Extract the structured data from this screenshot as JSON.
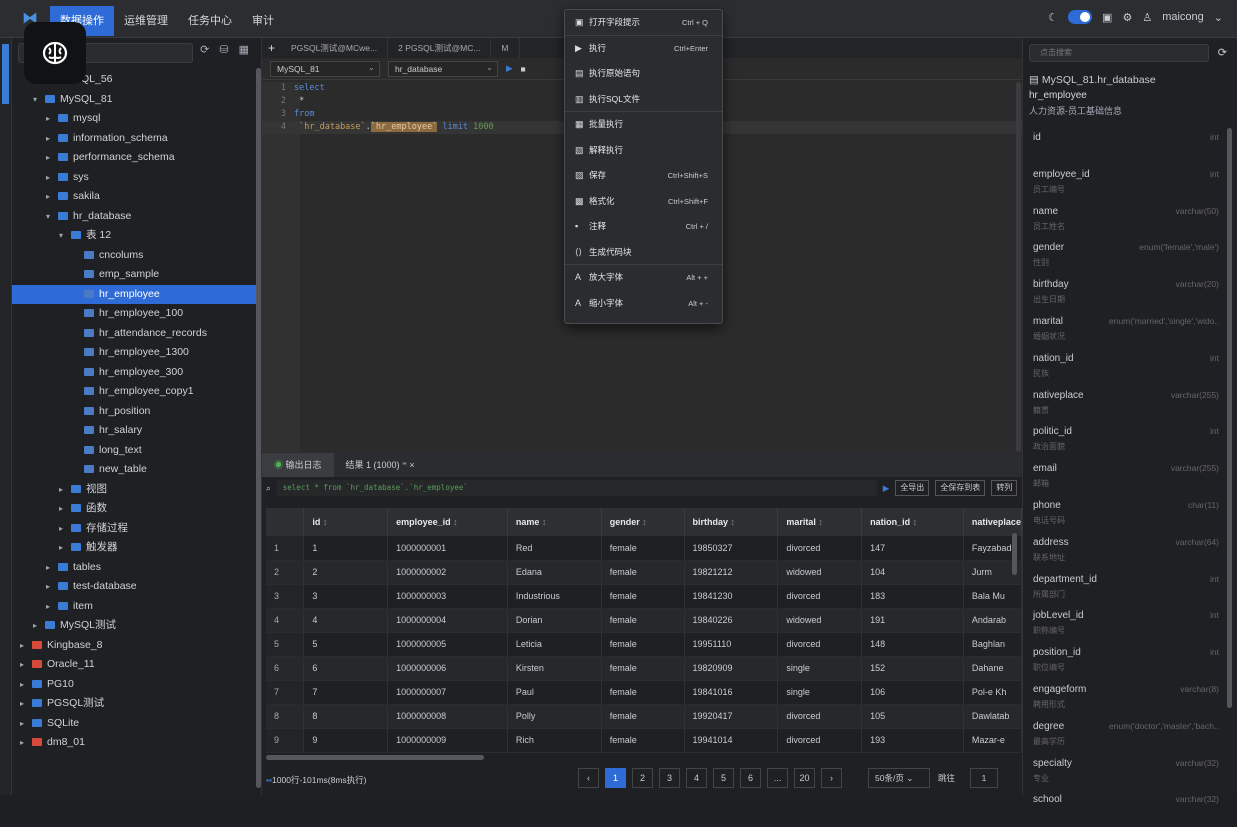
{
  "topbar": {
    "nav": [
      "数据操作",
      "运维管理",
      "任务中心",
      "审计"
    ],
    "user": "maicong"
  },
  "sidebar": {
    "tree": [
      {
        "label": "MySQL_56",
        "indent": 1,
        "arrow": "▸"
      },
      {
        "label": "MySQL_81",
        "indent": 1,
        "arrow": "▾"
      },
      {
        "label": "mysql",
        "indent": 2,
        "arrow": "▸"
      },
      {
        "label": "information_schema",
        "indent": 2,
        "arrow": "▸"
      },
      {
        "label": "performance_schema",
        "indent": 2,
        "arrow": "▸"
      },
      {
        "label": "sys",
        "indent": 2,
        "arrow": "▸"
      },
      {
        "label": "sakila",
        "indent": 2,
        "arrow": "▸"
      },
      {
        "label": "hr_database",
        "indent": 2,
        "arrow": "▾"
      },
      {
        "label": "表 12",
        "indent": 3,
        "arrow": "▾"
      },
      {
        "label": "cncolums",
        "indent": 4,
        "arrow": ""
      },
      {
        "label": "emp_sample",
        "indent": 4,
        "arrow": ""
      },
      {
        "label": "hr_employee",
        "indent": 4,
        "arrow": "",
        "selected": true
      },
      {
        "label": "hr_employee_100",
        "indent": 4,
        "arrow": ""
      },
      {
        "label": "hr_attendance_records",
        "indent": 4,
        "arrow": ""
      },
      {
        "label": "hr_employee_1300",
        "indent": 4,
        "arrow": ""
      },
      {
        "label": "hr_employee_300",
        "indent": 4,
        "arrow": ""
      },
      {
        "label": "hr_employee_copy1",
        "indent": 4,
        "arrow": ""
      },
      {
        "label": "hr_position",
        "indent": 4,
        "arrow": ""
      },
      {
        "label": "hr_salary",
        "indent": 4,
        "arrow": ""
      },
      {
        "label": "long_text",
        "indent": 4,
        "arrow": ""
      },
      {
        "label": "new_table",
        "indent": 4,
        "arrow": ""
      },
      {
        "label": "视图",
        "indent": 3,
        "arrow": "▸"
      },
      {
        "label": "函数",
        "indent": 3,
        "arrow": "▸"
      },
      {
        "label": "存储过程",
        "indent": 3,
        "arrow": "▸"
      },
      {
        "label": "触发器",
        "indent": 3,
        "arrow": "▸"
      },
      {
        "label": "tables",
        "indent": 2,
        "arrow": "▸"
      },
      {
        "label": "test-database",
        "indent": 2,
        "arrow": "▸"
      },
      {
        "label": "item",
        "indent": 2,
        "arrow": "▸"
      },
      {
        "label": "MySQL测试",
        "indent": 1,
        "arrow": "▸"
      },
      {
        "label": "Kingbase_8",
        "indent": 0,
        "arrow": "▸",
        "red": true
      },
      {
        "label": "Oracle_11",
        "indent": 0,
        "arrow": "▸",
        "red": true
      },
      {
        "label": "PG10",
        "indent": 0,
        "arrow": "▸"
      },
      {
        "label": "PGSQL测试",
        "indent": 0,
        "arrow": "▸"
      },
      {
        "label": "SQLite",
        "indent": 0,
        "arrow": "▸"
      },
      {
        "label": "dm8_01",
        "indent": 0,
        "arrow": "▸",
        "red": true
      }
    ]
  },
  "editor": {
    "tabs": [
      "PGSQL测试@MCwe...",
      "2 PGSQL测试@MC...",
      "M"
    ],
    "conn": "MySQL_81",
    "db": "hr_database"
  },
  "context_menu": {
    "items": [
      {
        "label": "打开字段提示",
        "shortcut": "Ctrl + Q",
        "icon": "▣"
      },
      {
        "label": "执行",
        "shortcut": "Ctrl+Enter",
        "icon": "▶"
      },
      {
        "label": "执行原始语句",
        "shortcut": "",
        "icon": "▤"
      },
      {
        "label": "执行SQL文件",
        "shortcut": "",
        "icon": "▥"
      },
      {
        "label": "批量执行",
        "shortcut": "",
        "icon": "▦"
      },
      {
        "label": "解释执行",
        "shortcut": "",
        "icon": "▧"
      },
      {
        "label": "保存",
        "shortcut": "Ctrl+Shift+S",
        "icon": "▨"
      },
      {
        "label": "格式化",
        "shortcut": "Ctrl+Shift+F",
        "icon": "▩"
      },
      {
        "label": "注释",
        "shortcut": "Ctrl + /",
        "icon": "▪"
      },
      {
        "label": "生成代码块",
        "shortcut": "",
        "icon": "⟨⟩"
      },
      {
        "label": "放大字体",
        "shortcut": "Alt + +",
        "icon": "A"
      },
      {
        "label": "缩小字体",
        "shortcut": "Alt + -",
        "icon": "A"
      }
    ]
  },
  "results": {
    "tabs": [
      "输出日志",
      "结果 1 (1000)"
    ],
    "sql": "select * from `hr_database`.`hr_employee`",
    "buttons": [
      "全导出",
      "全保存到表",
      "转列"
    ],
    "columns": [
      "id",
      "employee_id",
      "name",
      "gender",
      "birthday",
      "marital",
      "nation_id",
      "nativeplace"
    ],
    "rows": [
      [
        "1",
        "1",
        "1000000001",
        "Red",
        "female",
        "19850327",
        "divorced",
        "147",
        "Fayzabad"
      ],
      [
        "2",
        "2",
        "1000000002",
        "Edana",
        "female",
        "19821212",
        "widowed",
        "104",
        "Jurm"
      ],
      [
        "3",
        "3",
        "1000000003",
        "Industrious",
        "female",
        "19841230",
        "divorced",
        "183",
        "Bala Mu"
      ],
      [
        "4",
        "4",
        "1000000004",
        "Dorian",
        "female",
        "19840226",
        "widowed",
        "191",
        "Andarab"
      ],
      [
        "5",
        "5",
        "1000000005",
        "Leticia",
        "female",
        "19951110",
        "divorced",
        "148",
        "Baghlan"
      ],
      [
        "6",
        "6",
        "1000000006",
        "Kirsten",
        "female",
        "19820909",
        "single",
        "152",
        "Dahane"
      ],
      [
        "7",
        "7",
        "1000000007",
        "Paul",
        "female",
        "19841016",
        "single",
        "106",
        "Pol-e Kh"
      ],
      [
        "8",
        "8",
        "1000000008",
        "Polly",
        "female",
        "19920417",
        "divorced",
        "105",
        "Dawlatab"
      ],
      [
        "9",
        "9",
        "1000000009",
        "Rich",
        "female",
        "19941014",
        "divorced",
        "193",
        "Mazar-e"
      ]
    ],
    "status": "1000行-101ms(8ms执行)",
    "pages": [
      "1",
      "2",
      "3",
      "4",
      "5",
      "6",
      "...",
      "20"
    ],
    "page_size": "50条/页",
    "jump_label": "跳往",
    "jump_value": "1"
  },
  "right_panel": {
    "search_placeholder": "点击搜索",
    "conn": "MySQL_81.hr_database",
    "table": "hr_employee",
    "comment": "人力资源-员工基础信息",
    "fields": [
      {
        "name": "id",
        "type": "int",
        "comment": ""
      },
      {
        "name": "employee_id",
        "type": "int",
        "comment": "员工编号"
      },
      {
        "name": "name",
        "type": "varchar(50)",
        "comment": "员工姓名"
      },
      {
        "name": "gender",
        "type": "enum('female','male')",
        "comment": "性别"
      },
      {
        "name": "birthday",
        "type": "varchar(20)",
        "comment": "出生日期"
      },
      {
        "name": "marital",
        "type": "enum('married','single','wido...",
        "comment": "婚姻状况"
      },
      {
        "name": "nation_id",
        "type": "int",
        "comment": "民族"
      },
      {
        "name": "nativeplace",
        "type": "varchar(255)",
        "comment": "籍贯"
      },
      {
        "name": "politic_id",
        "type": "int",
        "comment": "政治面貌"
      },
      {
        "name": "email",
        "type": "varchar(255)",
        "comment": "邮箱"
      },
      {
        "name": "phone",
        "type": "char(11)",
        "comment": "电话号码"
      },
      {
        "name": "address",
        "type": "varchar(64)",
        "comment": "联系地址"
      },
      {
        "name": "department_id",
        "type": "int",
        "comment": "所属部门"
      },
      {
        "name": "jobLevel_id",
        "type": "int",
        "comment": "职称编号"
      },
      {
        "name": "position_id",
        "type": "int",
        "comment": "职位编号"
      },
      {
        "name": "engageform",
        "type": "varchar(8)",
        "comment": "聘用形式"
      },
      {
        "name": "degree",
        "type": "enum('doctor','master','bach...",
        "comment": "最高学历"
      },
      {
        "name": "specialty",
        "type": "varchar(32)",
        "comment": "专业"
      },
      {
        "name": "school",
        "type": "varchar(32)",
        "comment": ""
      }
    ]
  }
}
